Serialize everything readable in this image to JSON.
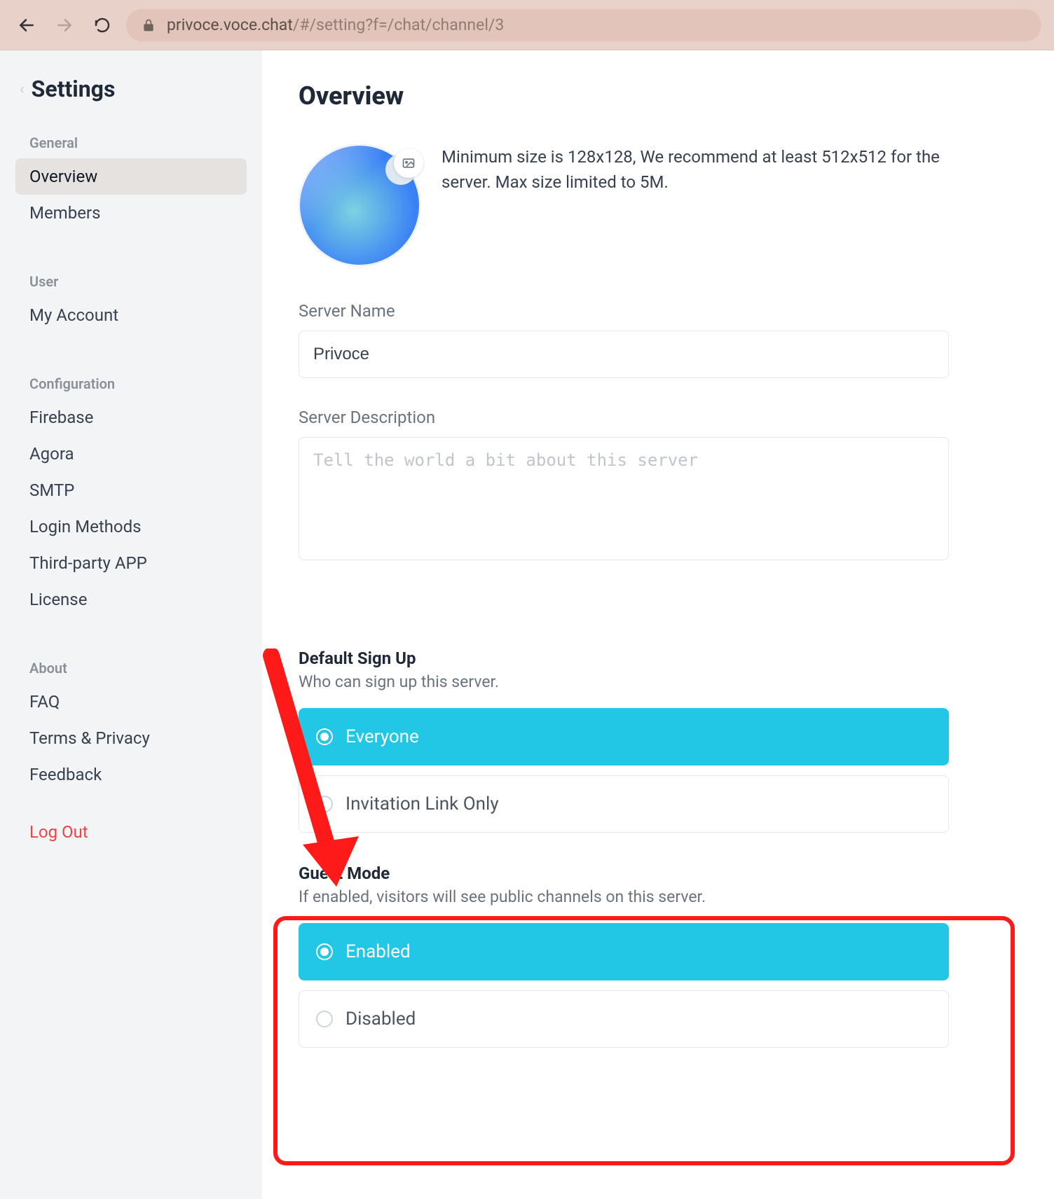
{
  "browser": {
    "url_host": "privoce.voce.chat",
    "url_path": "/#/setting?f=/chat/channel/3"
  },
  "sidebar": {
    "title": "Settings",
    "groups": [
      {
        "label": "General",
        "items": [
          {
            "label": "Overview",
            "active": true
          },
          {
            "label": "Members",
            "active": false
          }
        ]
      },
      {
        "label": "User",
        "items": [
          {
            "label": "My Account",
            "active": false
          }
        ]
      },
      {
        "label": "Configuration",
        "items": [
          {
            "label": "Firebase",
            "active": false
          },
          {
            "label": "Agora",
            "active": false
          },
          {
            "label": "SMTP",
            "active": false
          },
          {
            "label": "Login Methods",
            "active": false
          },
          {
            "label": "Third-party APP",
            "active": false
          },
          {
            "label": "License",
            "active": false
          }
        ]
      },
      {
        "label": "About",
        "items": [
          {
            "label": "FAQ",
            "active": false
          },
          {
            "label": "Terms & Privacy",
            "active": false
          },
          {
            "label": "Feedback",
            "active": false
          }
        ]
      }
    ],
    "logout_label": "Log Out"
  },
  "main": {
    "title": "Overview",
    "logo_recommendation": "Minimum size is 128x128, We recommend at least 512x512 for the server. Max size limited to 5M.",
    "server_name_label": "Server Name",
    "server_name_value": "Privoce",
    "server_description_label": "Server Description",
    "server_description_placeholder": "Tell the world a bit about this server",
    "server_description_value": "",
    "signup": {
      "title": "Default Sign Up",
      "subtitle": "Who can sign up this server.",
      "options": [
        {
          "label": "Everyone",
          "selected": true
        },
        {
          "label": "Invitation Link Only",
          "selected": false
        }
      ]
    },
    "guest_mode": {
      "title": "Guest Mode",
      "subtitle": "If enabled, visitors will see public channels on this server.",
      "options": [
        {
          "label": "Enabled",
          "selected": true
        },
        {
          "label": "Disabled",
          "selected": false
        }
      ]
    }
  }
}
